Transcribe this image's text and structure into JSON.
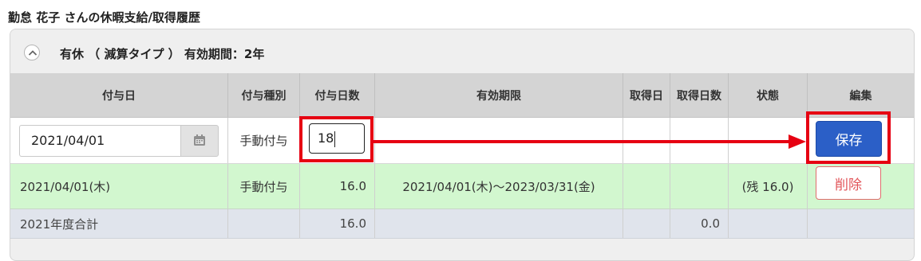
{
  "page_title": "勤怠 花子 さんの休暇支給/取得履歴",
  "panel": {
    "title": "有休 （ 減算タイプ ） 有効期間：2年",
    "collapse_icon": "chevron-up-icon"
  },
  "table": {
    "headers": [
      "付与日",
      "付与種別",
      "付与日数",
      "有効期限",
      "取得日",
      "取得日数",
      "状態",
      "編集"
    ],
    "edit_row": {
      "grant_date": "2021/04/01",
      "grant_type": "手動付与",
      "grant_days": "18",
      "save_label": "保存",
      "calendar_icon": "calendar-icon"
    },
    "data_row": {
      "grant_date": "2021/04/01(木)",
      "grant_type": "手動付与",
      "grant_days": "16.0",
      "validity": "2021/04/01(木)～2023/03/31(金)",
      "status": "(残 16.0)",
      "delete_label": "削除"
    },
    "total_row": {
      "label": "2021年度合計",
      "grant_days": "16.0",
      "taken_days": "0.0"
    }
  },
  "colors": {
    "highlight": "#e60012",
    "save_button": "#2b5fc7",
    "data_row_bg": "#d2f7cf",
    "total_row_bg": "#e0e4ec",
    "header_bg": "#d4d4d4"
  }
}
